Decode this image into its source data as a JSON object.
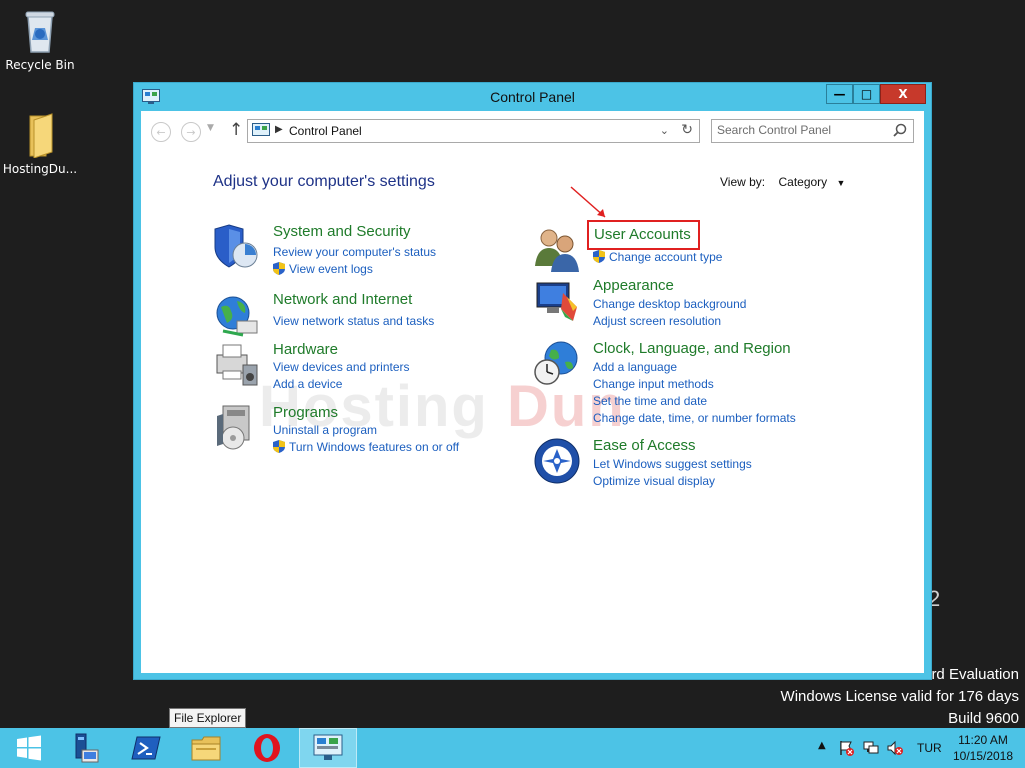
{
  "desktop": {
    "icons": [
      {
        "label": "Recycle Bin",
        "icon": "recycle-bin-icon"
      },
      {
        "label": "HostingDu...",
        "icon": "folder-icon"
      }
    ],
    "watermark_fragment": "2",
    "evaluation_line": "rd Evaluation",
    "license_line": "Windows License valid for 176 days",
    "build_line": "Build 9600",
    "brand_watermark_a": "Hosting",
    "brand_watermark_b": "Dun"
  },
  "window": {
    "title": "Control Panel",
    "buttons": {
      "minimize": "—",
      "maximize": "□",
      "close": "X"
    }
  },
  "address_bar": {
    "path": "Control Panel",
    "search_placeholder": "Search Control Panel"
  },
  "content": {
    "heading": "Adjust your computer's settings",
    "view_by_label": "View by:",
    "view_by_value": "Category",
    "categories": [
      {
        "title": "System and Security",
        "icon": "system-security-icon",
        "links": [
          {
            "text": "Review your computer's status",
            "shield": false
          },
          {
            "text": "View event logs",
            "shield": true
          }
        ]
      },
      {
        "title": "Network and Internet",
        "icon": "network-icon",
        "links": [
          {
            "text": "View network status and tasks",
            "shield": false
          }
        ]
      },
      {
        "title": "Hardware",
        "icon": "printer-icon",
        "links": [
          {
            "text": "View devices and printers",
            "shield": false
          },
          {
            "text": "Add a device",
            "shield": false
          }
        ]
      },
      {
        "title": "Programs",
        "icon": "programs-icon",
        "links": [
          {
            "text": "Uninstall a program",
            "shield": false
          },
          {
            "text": "Turn Windows features on or off",
            "shield": true
          }
        ]
      },
      {
        "title": "User Accounts",
        "icon": "users-icon",
        "links": [
          {
            "text": "Change account type",
            "shield": true
          }
        ]
      },
      {
        "title": "Appearance",
        "icon": "appearance-icon",
        "links": [
          {
            "text": "Change desktop background",
            "shield": false
          },
          {
            "text": "Adjust screen resolution",
            "shield": false
          }
        ]
      },
      {
        "title": "Clock, Language, and Region",
        "icon": "clock-globe-icon",
        "links": [
          {
            "text": "Add a language",
            "shield": false
          },
          {
            "text": "Change input methods",
            "shield": false
          },
          {
            "text": "Set the time and date",
            "shield": false
          },
          {
            "text": "Change date, time, or number formats",
            "shield": false
          }
        ]
      },
      {
        "title": "Ease of Access",
        "icon": "ease-of-access-icon",
        "links": [
          {
            "text": "Let Windows suggest settings",
            "shield": false
          },
          {
            "text": "Optimize visual display",
            "shield": false
          }
        ]
      }
    ]
  },
  "tooltip": "File Explorer",
  "taskbar": {
    "items": [
      "start-icon",
      "server-manager-icon",
      "powershell-icon",
      "file-explorer-icon",
      "opera-icon",
      "control-panel-icon"
    ],
    "tray": {
      "language": "TUR",
      "time": "11:20 AM",
      "date": "10/15/2018"
    }
  },
  "colors": {
    "accent": "#4cc3e6",
    "link": "#1c5fbf",
    "category_title": "#1f7b2a",
    "heading": "#1e3287",
    "highlight": "#e02020"
  }
}
